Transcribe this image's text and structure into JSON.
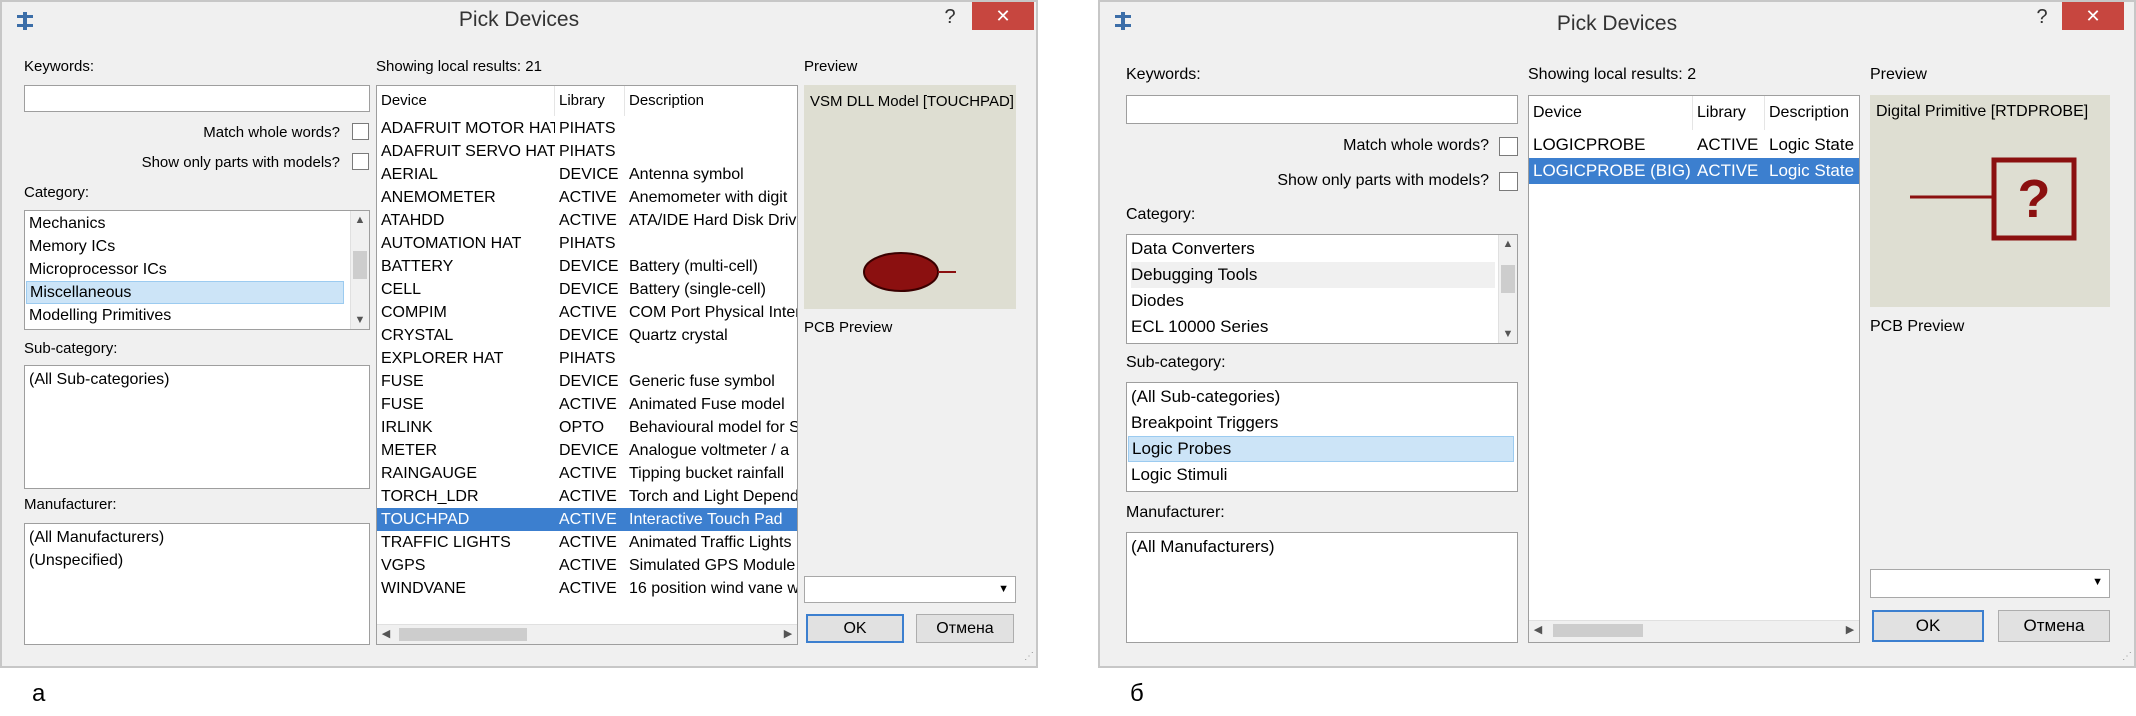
{
  "shared": {
    "title": "Pick Devices",
    "help": "?",
    "close": "✕",
    "keywords_label": "Keywords:",
    "match_whole_words": "Match whole words?",
    "show_only_models": "Show only parts with models?",
    "category_label": "Category:",
    "subcategory_label": "Sub-category:",
    "manufacturer_label": "Manufacturer:",
    "preview_label": "Preview",
    "pcb_preview_label": "PCB Preview",
    "ok": "OK",
    "cancel": "Отмена",
    "col_device": "Device",
    "col_library": "Library",
    "col_description": "Description",
    "up_arrow": "▲",
    "down_arrow": "▼",
    "left_arrow": "◀",
    "right_arrow": "▶",
    "combo_arrow": "▼",
    "grip": "⋰"
  },
  "dialog_a": {
    "caption": "а",
    "keywords_value": "",
    "results_label": "Showing local results: 21",
    "categories": [
      "Mechanics",
      "Memory ICs",
      "Microprocessor ICs",
      "Miscellaneous",
      "Modelling Primitives"
    ],
    "subcategories": [
      "(All Sub-categories)"
    ],
    "manufacturers": [
      "(All Manufacturers)",
      "(Unspecified)"
    ],
    "rows": [
      {
        "device": "ADAFRUIT MOTOR HAT",
        "library": "PIHATS",
        "description": ""
      },
      {
        "device": "ADAFRUIT SERVO HAT",
        "library": "PIHATS",
        "description": ""
      },
      {
        "device": "AERIAL",
        "library": "DEVICE",
        "description": "Antenna symbol"
      },
      {
        "device": "ANEMOMETER",
        "library": "ACTIVE",
        "description": "Anemometer with digit"
      },
      {
        "device": "ATAHDD",
        "library": "ACTIVE",
        "description": "ATA/IDE Hard Disk Drive"
      },
      {
        "device": "AUTOMATION HAT",
        "library": "PIHATS",
        "description": ""
      },
      {
        "device": "BATTERY",
        "library": "DEVICE",
        "description": "Battery (multi-cell)"
      },
      {
        "device": "CELL",
        "library": "DEVICE",
        "description": "Battery (single-cell)"
      },
      {
        "device": "COMPIM",
        "library": "ACTIVE",
        "description": "COM Port Physical Inter"
      },
      {
        "device": "CRYSTAL",
        "library": "DEVICE",
        "description": "Quartz crystal"
      },
      {
        "device": "EXPLORER HAT",
        "library": "PIHATS",
        "description": ""
      },
      {
        "device": "FUSE",
        "library": "DEVICE",
        "description": "Generic fuse symbol"
      },
      {
        "device": "FUSE",
        "library": "ACTIVE",
        "description": "Animated Fuse model"
      },
      {
        "device": "IRLINK",
        "library": "OPTO",
        "description": "Behavioural model for S"
      },
      {
        "device": "METER",
        "library": "DEVICE",
        "description": "Analogue voltmeter / a"
      },
      {
        "device": "RAINGAUGE",
        "library": "ACTIVE",
        "description": "Tipping bucket rainfall"
      },
      {
        "device": "TORCH_LDR",
        "library": "ACTIVE",
        "description": "Torch and Light Depend"
      },
      {
        "device": "TOUCHPAD",
        "library": "ACTIVE",
        "description": "Interactive Touch Pad"
      },
      {
        "device": "TRAFFIC LIGHTS",
        "library": "ACTIVE",
        "description": "Animated Traffic Lights"
      },
      {
        "device": "VGPS",
        "library": "ACTIVE",
        "description": "Simulated GPS Module"
      },
      {
        "device": "WINDVANE",
        "library": "ACTIVE",
        "description": "16 position wind vane w"
      }
    ],
    "preview_title": "VSM DLL Model [TOUCHPAD]",
    "colors": {
      "selected_row": "#3c7fcf",
      "preview_symbol": "#8b1010"
    }
  },
  "dialog_b": {
    "caption": "б",
    "keywords_value": "",
    "results_label": "Showing local results: 2",
    "categories": [
      "Data Converters",
      "Debugging Tools",
      "Diodes",
      "ECL 10000 Series"
    ],
    "subcategories": [
      "(All Sub-categories)",
      "Breakpoint Triggers",
      "Logic Probes",
      "Logic Stimuli"
    ],
    "manufacturers": [
      "(All Manufacturers)"
    ],
    "rows": [
      {
        "device": "LOGICPROBE",
        "library": "ACTIVE",
        "description": "Logic State"
      },
      {
        "device": "LOGICPROBE (BIG)",
        "library": "ACTIVE",
        "description": "Logic State"
      }
    ],
    "preview_title": "Digital Primitive [RTDPROBE]",
    "probe_symbol": "?",
    "colors": {
      "selected_row": "#3c7fcf",
      "preview_symbol": "#8b1010"
    }
  }
}
